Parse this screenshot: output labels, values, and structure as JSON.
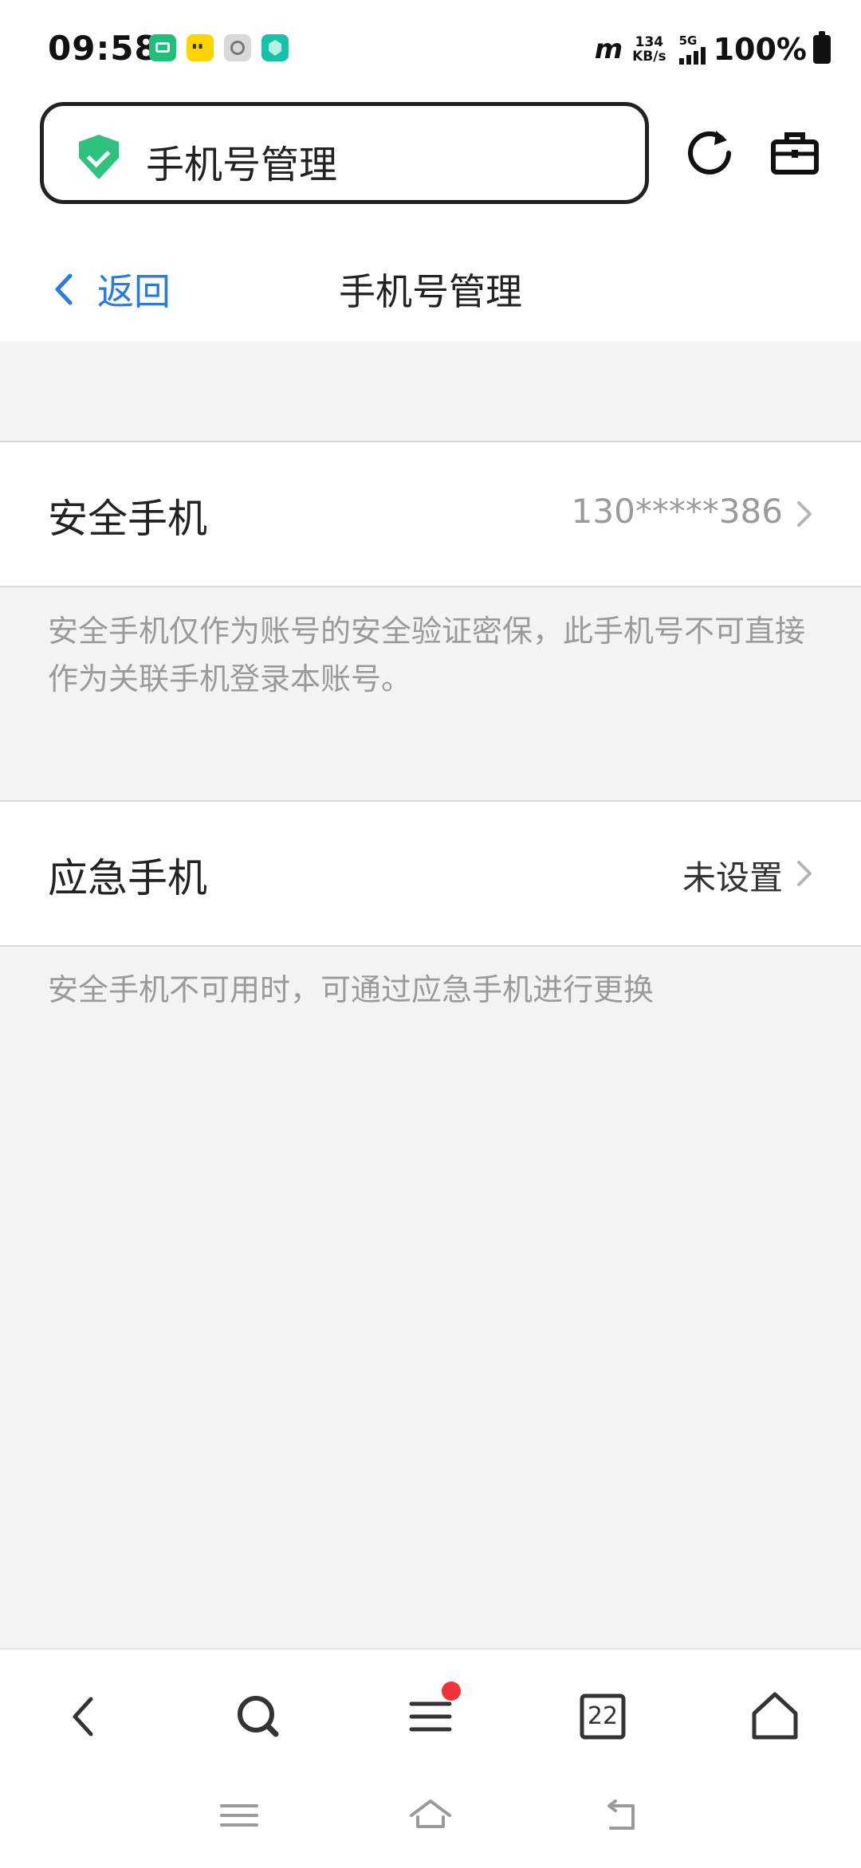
{
  "status_bar": {
    "time": "09:58",
    "net_speed_value": "134",
    "net_speed_unit": "KB/s",
    "network_type": "5G",
    "carrier_icon": "m-logo-icon",
    "battery_percent": "100%"
  },
  "browser": {
    "url_text": "手机号管理",
    "security_icon": "shield-check-icon"
  },
  "page": {
    "back_label": "返回",
    "title": "手机号管理"
  },
  "security_phone": {
    "label": "安全手机",
    "value": "130*****386",
    "hint": "安全手机仅作为账号的安全验证密保，此手机号不可直接作为关联手机登录本账号。"
  },
  "emergency_phone": {
    "label": "应急手机",
    "value": "未设置",
    "hint": "安全手机不可用时，可通过应急手机进行更换"
  },
  "bottom_nav": {
    "tabs_count": "22"
  },
  "colors": {
    "accent": "#2b7ade",
    "background": "#f3f3f3",
    "hint_text": "#9a9a9a",
    "badge": "#f0343a"
  }
}
